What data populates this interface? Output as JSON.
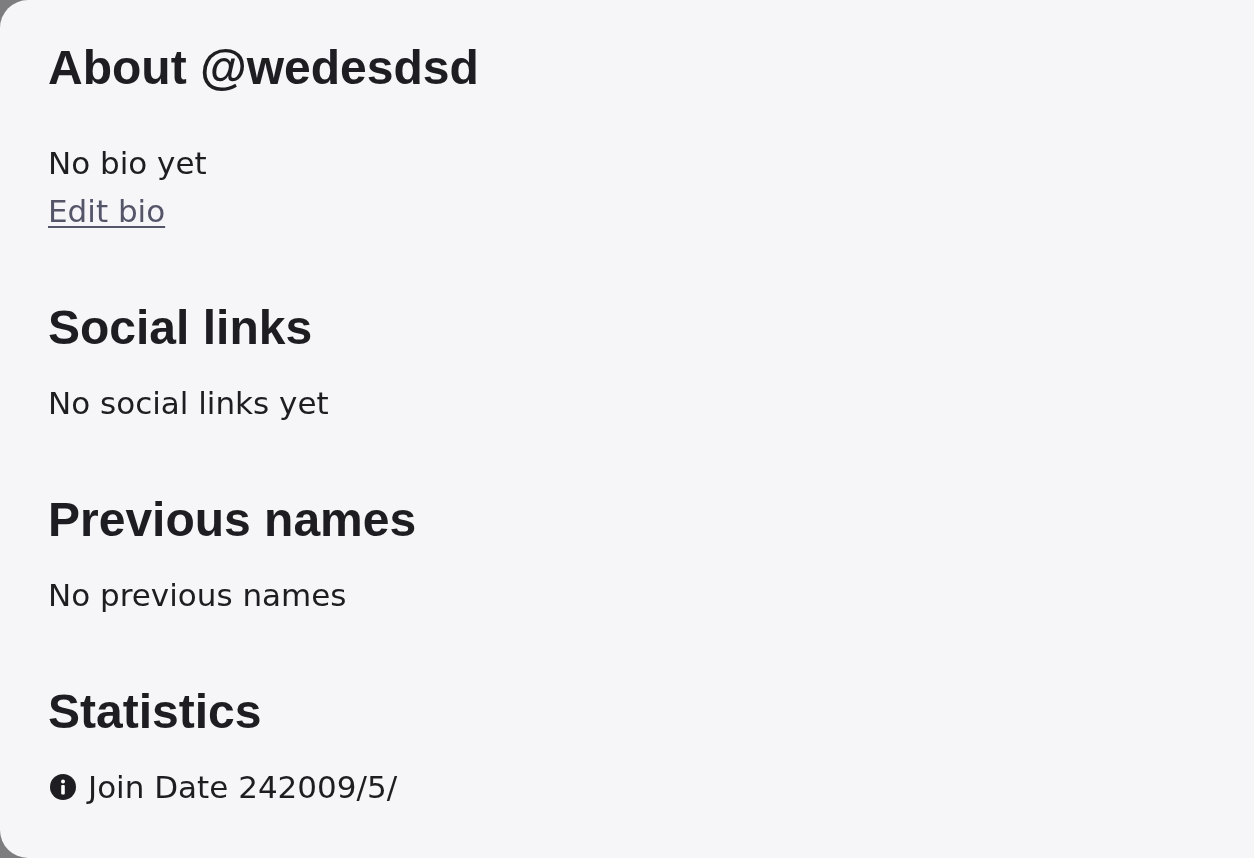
{
  "about": {
    "title": "About @wedesdsd",
    "bio": "No bio yet",
    "edit_link": "Edit bio"
  },
  "social_links": {
    "title": "Social links",
    "empty_text": "No social links yet"
  },
  "previous_names": {
    "title": "Previous names",
    "empty_text": "No previous names"
  },
  "statistics": {
    "title": "Statistics",
    "items": [
      {
        "kind": "info",
        "text": "Join Date 242009/5/"
      }
    ]
  }
}
